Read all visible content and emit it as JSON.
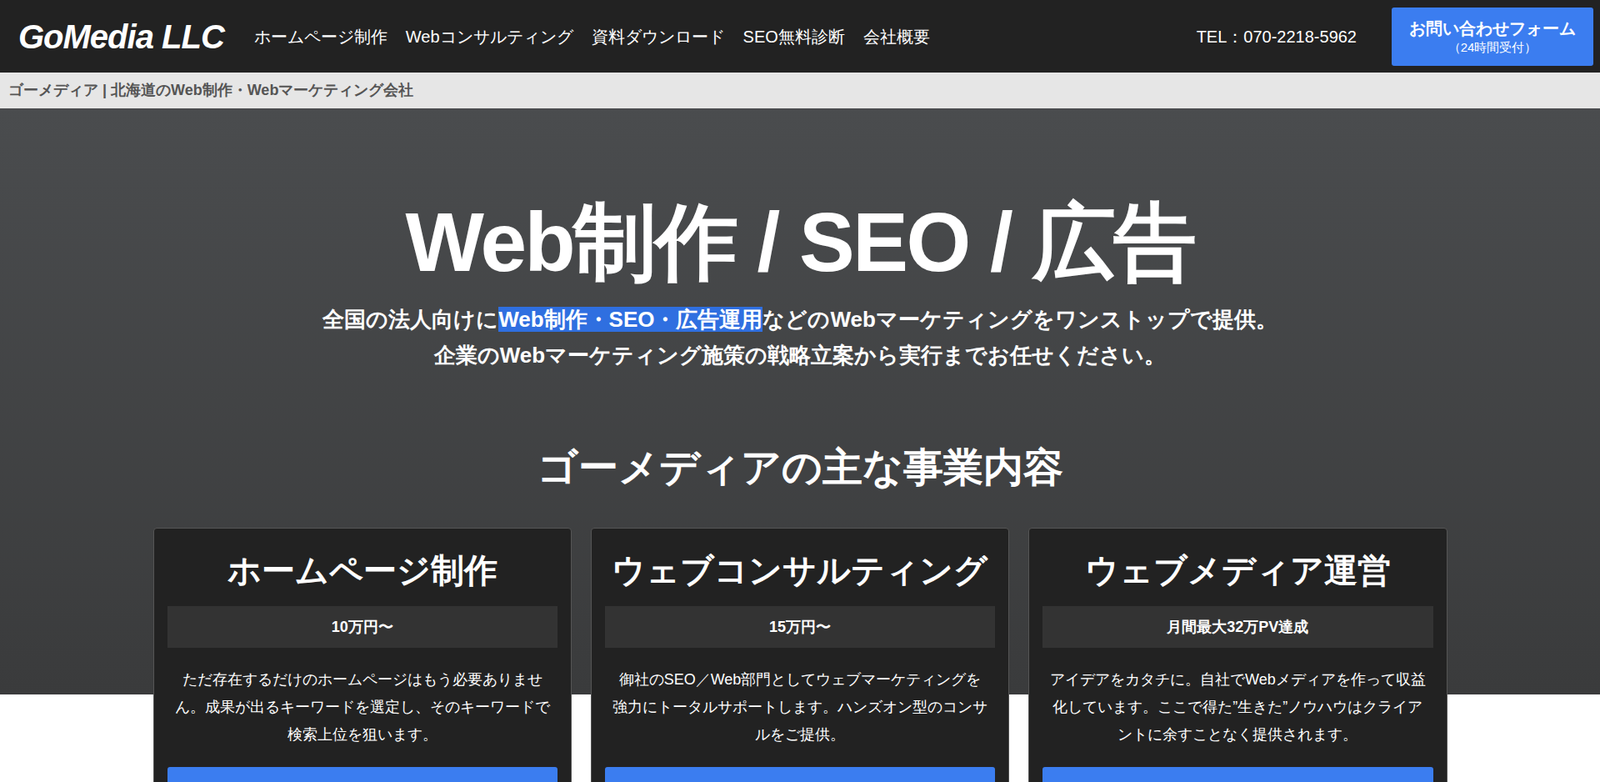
{
  "header": {
    "logo": "GoMedia LLC",
    "nav": [
      "ホームページ制作",
      "Webコンサルティング",
      "資料ダウンロード",
      "SEO無料診断",
      "会社概要"
    ],
    "tel": "TEL：070-2218-5962",
    "contact": {
      "label": "お問い合わせフォーム",
      "sub": "（24時間受付）"
    }
  },
  "breadcrumb": "ゴーメディア | 北海道のWeb制作・Webマーケティング会社",
  "hero": {
    "title": "Web制作 / SEO / 広告",
    "subtitle_lines": [
      [
        {
          "text": "全国の法人向けに",
          "highlighted": false
        },
        {
          "text": "Web制作・SEO・広告運用",
          "highlighted": true
        },
        {
          "text": "などのWebマーケティングをワンストップで提供。",
          "highlighted": false
        }
      ],
      [
        {
          "text": "企業のWebマーケティング施策の戦略立案から実行までお任せください。",
          "highlighted": false
        }
      ]
    ]
  },
  "section_title": "ゴーメディアの主な事業内容",
  "cards": [
    {
      "title": "ホームページ制作",
      "price": "10万円〜",
      "description": "ただ存在するだけのホームページはもう必要ありません。成果が出るキーワードを選定し、そのキーワードで検索上位を狙います。"
    },
    {
      "title": "ウェブコンサルティング",
      "price": "15万円〜",
      "description": "御社のSEO／Web部門としてウェブマーケティングを強力にトータルサポートします。ハンズオン型のコンサルをご提供。"
    },
    {
      "title": "ウェブメディア運営",
      "price": "月間最大32万PV達成",
      "description": "アイデアをカタチに。自社でWebメディアを作って収益化しています。ここで得た”生きた”ノウハウはクライアントに余すことなく提供されます。"
    }
  ]
}
